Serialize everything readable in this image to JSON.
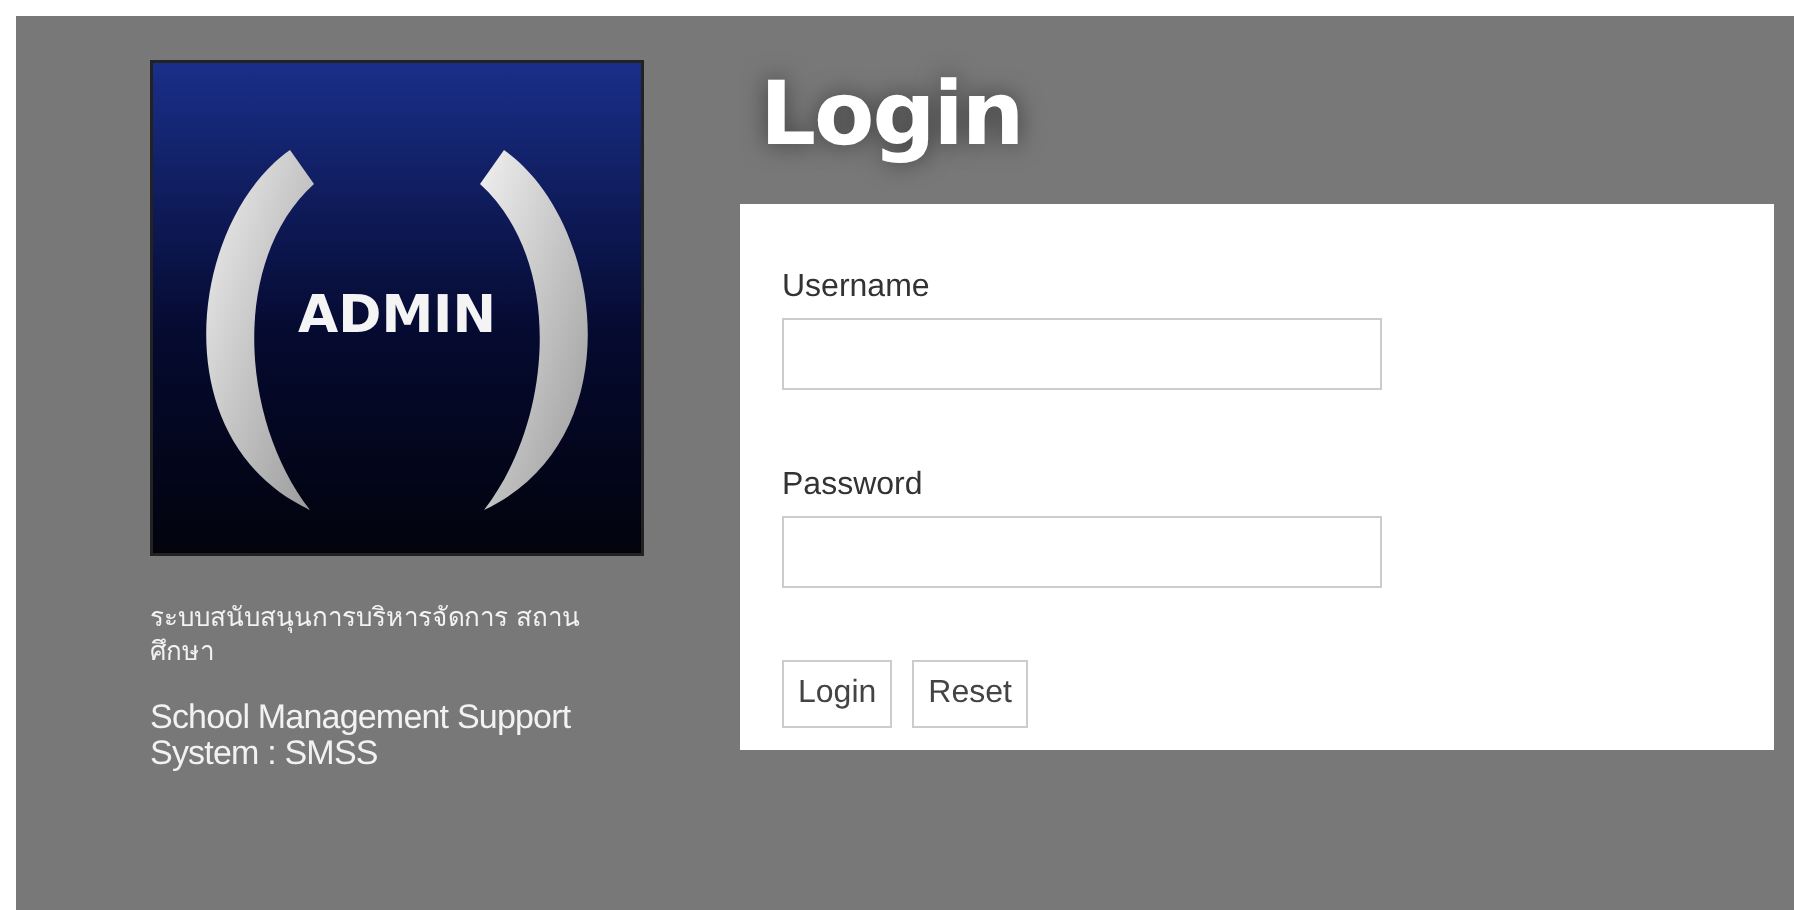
{
  "logo": {
    "text": "ADMIN"
  },
  "system_name_thai": "ระบบสนับสนุนการบริหารจัดการ สถานศึกษา",
  "system_name_english": "School Management Support System : SMSS",
  "title": "Login",
  "fields": [
    {
      "label": "Username"
    },
    {
      "label": "Password"
    }
  ],
  "buttons": [
    "Login",
    "Reset"
  ]
}
